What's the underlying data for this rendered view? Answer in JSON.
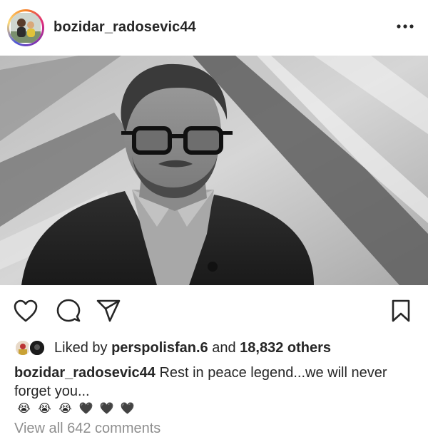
{
  "post": {
    "username": "bozidar_radosevic44",
    "more_icon": "three-dots-icon"
  },
  "photo": {
    "style": "grayscale",
    "icon": "portrait-photo"
  },
  "actions": {
    "like_icon": "heart-outline-icon",
    "comment_icon": "comment-bubble-icon",
    "share_icon": "paper-plane-icon",
    "save_icon": "bookmark-icon"
  },
  "likes": {
    "prefix": "Liked by",
    "liker": "perspolisfan.6",
    "conjunction": "and",
    "count": "18,832 others"
  },
  "caption": {
    "username": "bozidar_radosevic44",
    "text": "Rest in peace legend...we will never forget you...",
    "emojis": [
      "😭",
      "😭",
      "😭",
      "🖤",
      "🖤",
      "🖤"
    ]
  },
  "comments": {
    "view_all": "View all 642 comments"
  }
}
